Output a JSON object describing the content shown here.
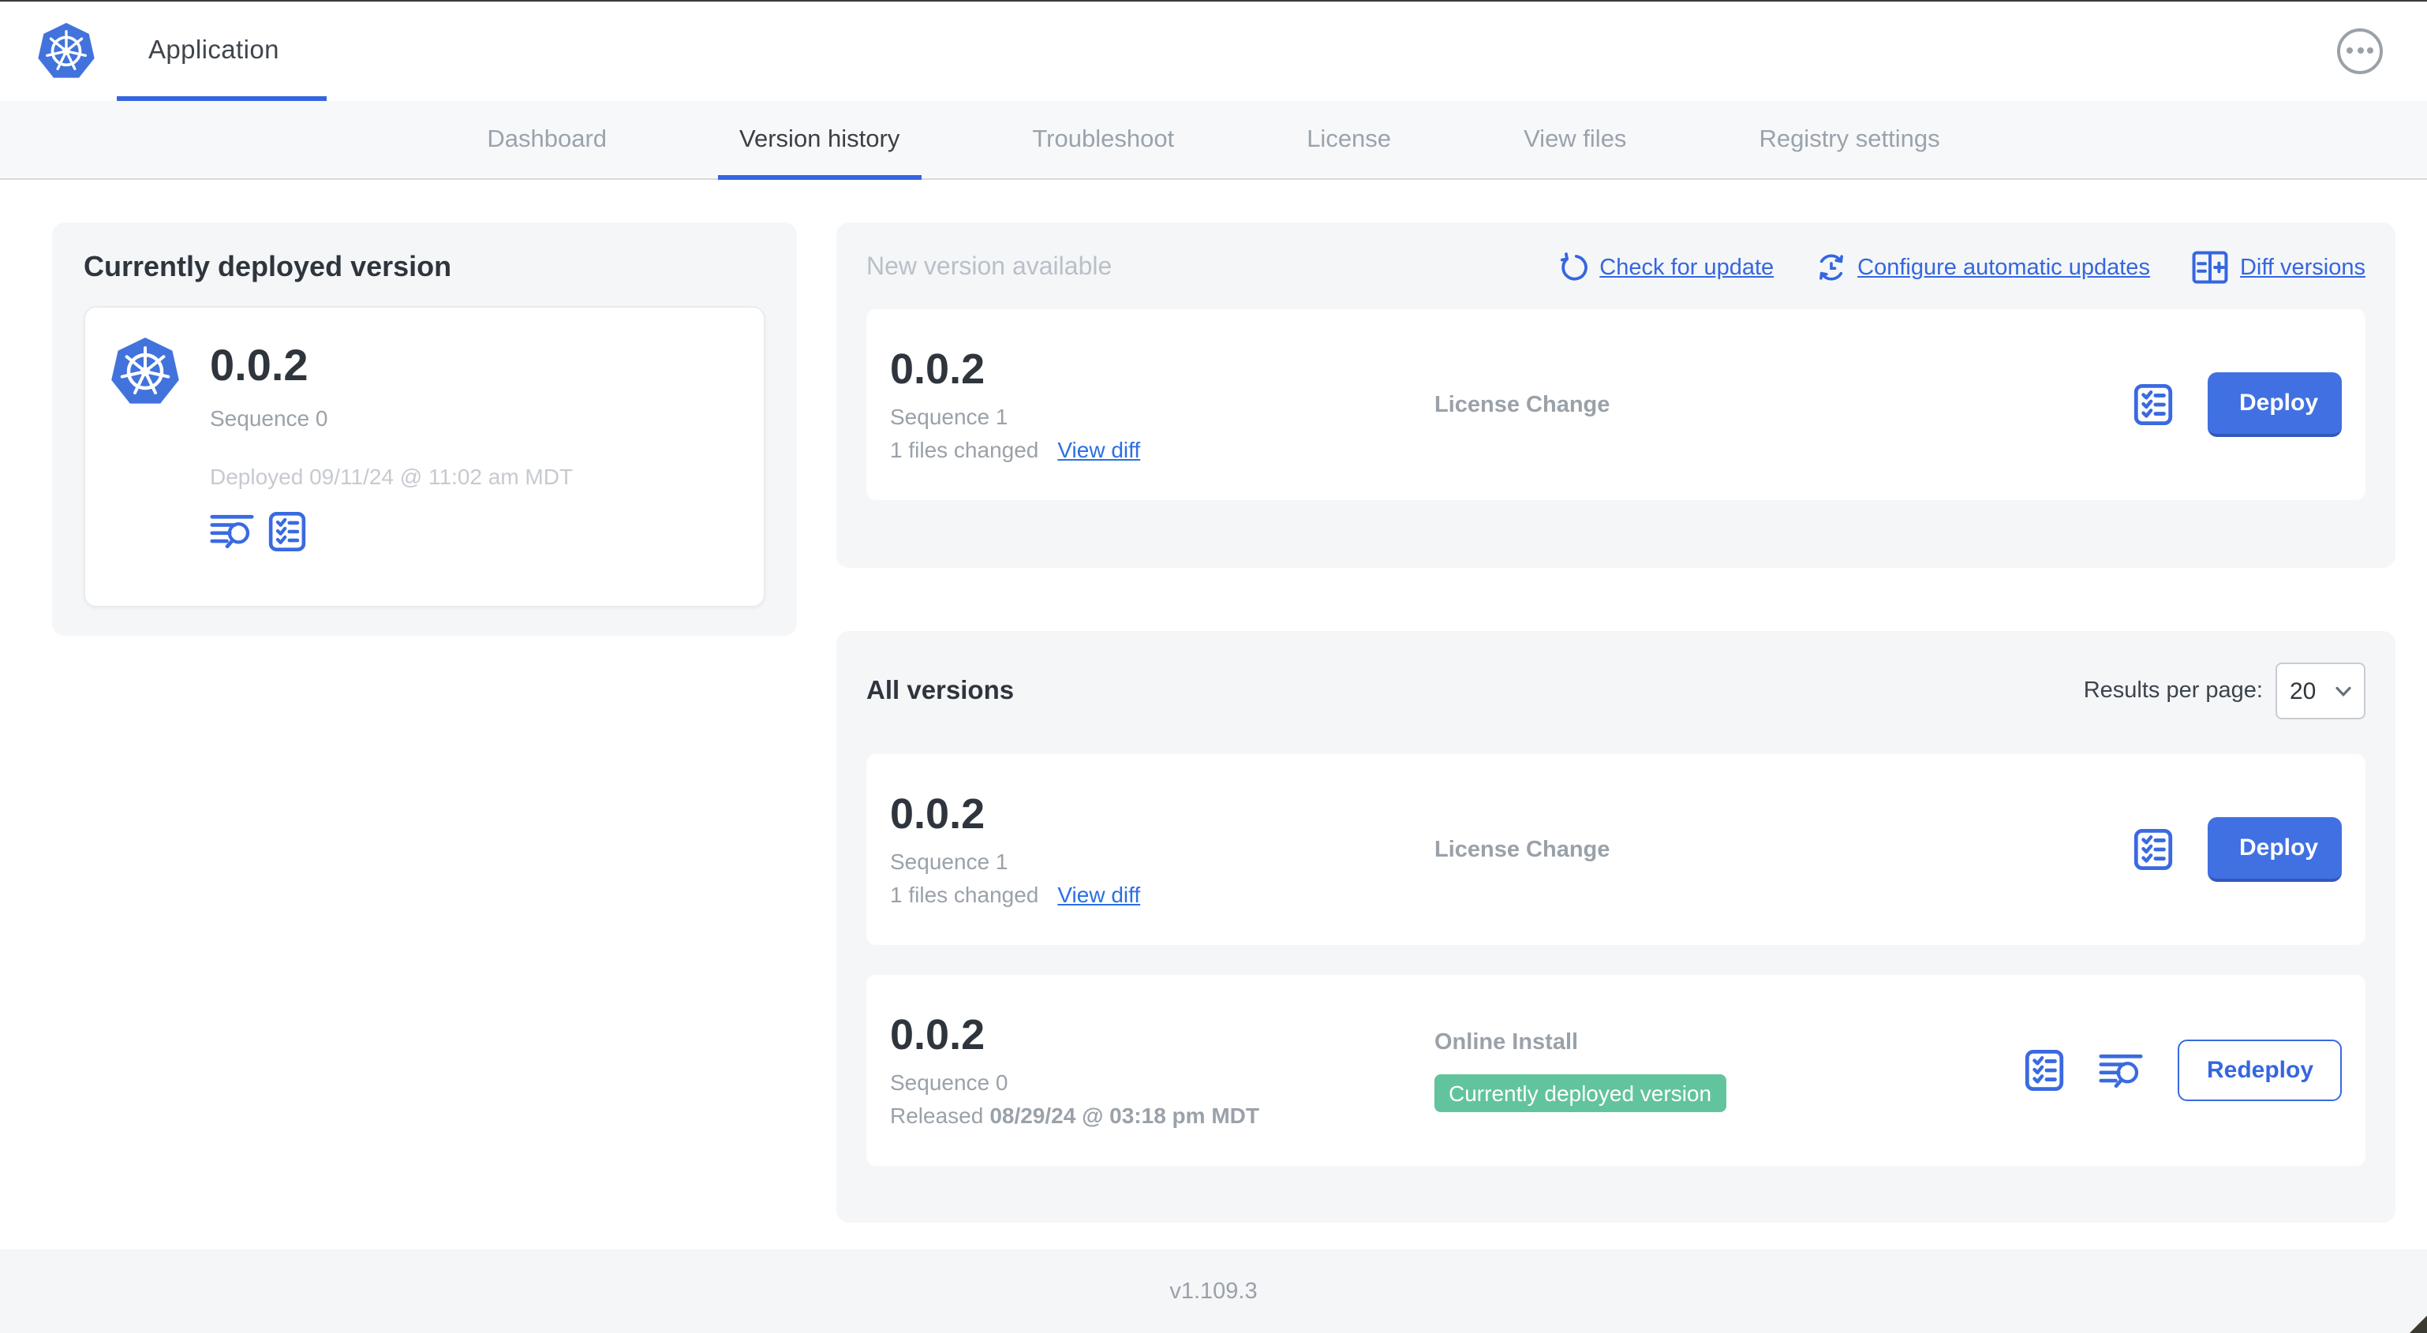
{
  "theme": {
    "accent": "#3566e0",
    "icon_blue": "#3a6ae0",
    "button_blue": "#4070e2",
    "badge_green": "#62c49c",
    "panel_gray": "#f4f6f8",
    "nav_gray": "#9aa3ac",
    "text_dark": "#2f353c",
    "text_gray": "#9aa1a9",
    "text_light": "#c6cad0"
  },
  "topbar": {
    "app_tab": "Application",
    "logo_icon": "kubernetes-logo",
    "menu_icon": "ellipsis-menu"
  },
  "nav": {
    "tabs": [
      {
        "label": "Dashboard"
      },
      {
        "label": "Version history",
        "active": true
      },
      {
        "label": "Troubleshoot"
      },
      {
        "label": "License"
      },
      {
        "label": "View files"
      },
      {
        "label": "Registry settings"
      }
    ]
  },
  "current": {
    "panel_title": "Currently deployed version",
    "version": "0.0.2",
    "sequence": "Sequence 0",
    "deployed": "Deployed 09/11/24 @ 11:02 am MDT",
    "icons": [
      "logs-icon",
      "preflight-checklist-icon"
    ]
  },
  "new_version": {
    "panel_title": "New version available",
    "actions": [
      {
        "label": "Check for update",
        "icon": "refresh-icon"
      },
      {
        "label": "Configure automatic updates",
        "icon": "auto-update-clock-icon"
      },
      {
        "label": "Diff versions",
        "icon": "diff-columns-icon"
      }
    ],
    "card": {
      "version": "0.0.2",
      "sequence": "Sequence 1",
      "files_changed": "1 files changed",
      "view_diff": "View diff",
      "source": "License Change",
      "deploy": "Deploy"
    }
  },
  "all_versions": {
    "panel_title": "All versions",
    "results_label": "Results per page:",
    "results_value": "20",
    "rows": [
      {
        "version": "0.0.2",
        "sequence": "Sequence 1",
        "files_changed": "1 files changed",
        "view_diff": "View diff",
        "source": "License Change",
        "deploy": "Deploy"
      },
      {
        "version": "0.0.2",
        "sequence": "Sequence 0",
        "released_prefix": "Released",
        "released": "08/29/24 @ 03:18 pm MDT",
        "source": "Online Install",
        "badge": "Currently deployed version",
        "redeploy": "Redeploy"
      }
    ]
  },
  "footer": {
    "version": "v1.109.3"
  }
}
